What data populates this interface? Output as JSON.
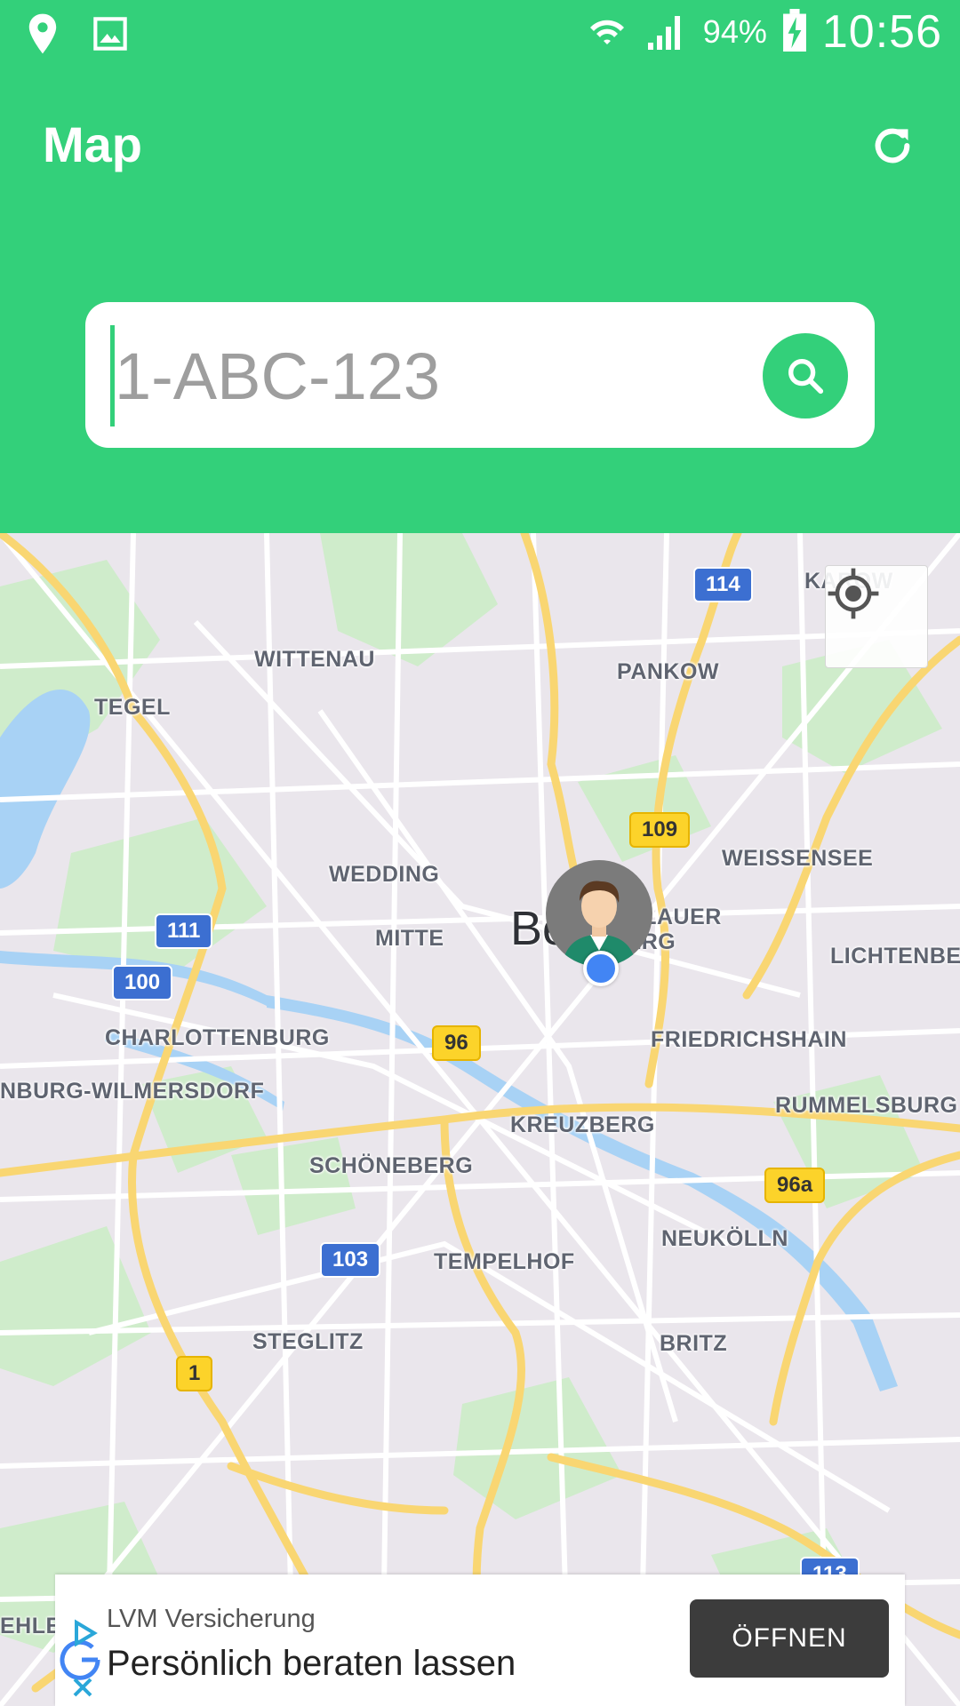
{
  "statusbar": {
    "battery": "94%",
    "time": "10:56"
  },
  "appbar": {
    "title": "Map"
  },
  "search": {
    "placeholder": "1-ABC-123",
    "value": ""
  },
  "map": {
    "city_label": "Berlin",
    "district_labels": [
      "KAROW",
      "WITTENAU",
      "PANKOW",
      "TEGEL",
      "WEISSENSEE",
      "WEDDING",
      "PRENZLAUER",
      "BERG",
      "MITTE",
      "LICHTENBE",
      "CHARLOTTENBURG",
      "FRIEDRICHSHAIN",
      "NBURG-WILMERSDORF",
      "RUMMELSBURG",
      "KREUZBERG",
      "SCHÖNEBERG",
      "NEUKÖLLN",
      "TEMPELHOF",
      "STEGLITZ",
      "BRITZ",
      "EHLE"
    ],
    "road_shields": [
      "114",
      "109",
      "111",
      "100",
      "96",
      "96a",
      "103",
      "1",
      "113"
    ]
  },
  "ad": {
    "brand": "LVM Versicherung",
    "headline": "Persönlich beraten lassen",
    "cta": "ÖFFNEN"
  },
  "colors": {
    "primary": "#33d07a",
    "map_background": "#eae6ec",
    "park": "#cfeccb",
    "water": "#a8d2f5",
    "major_road": "#f9d672",
    "minor_road": "#ffffff",
    "location_dot": "#4285f4"
  }
}
